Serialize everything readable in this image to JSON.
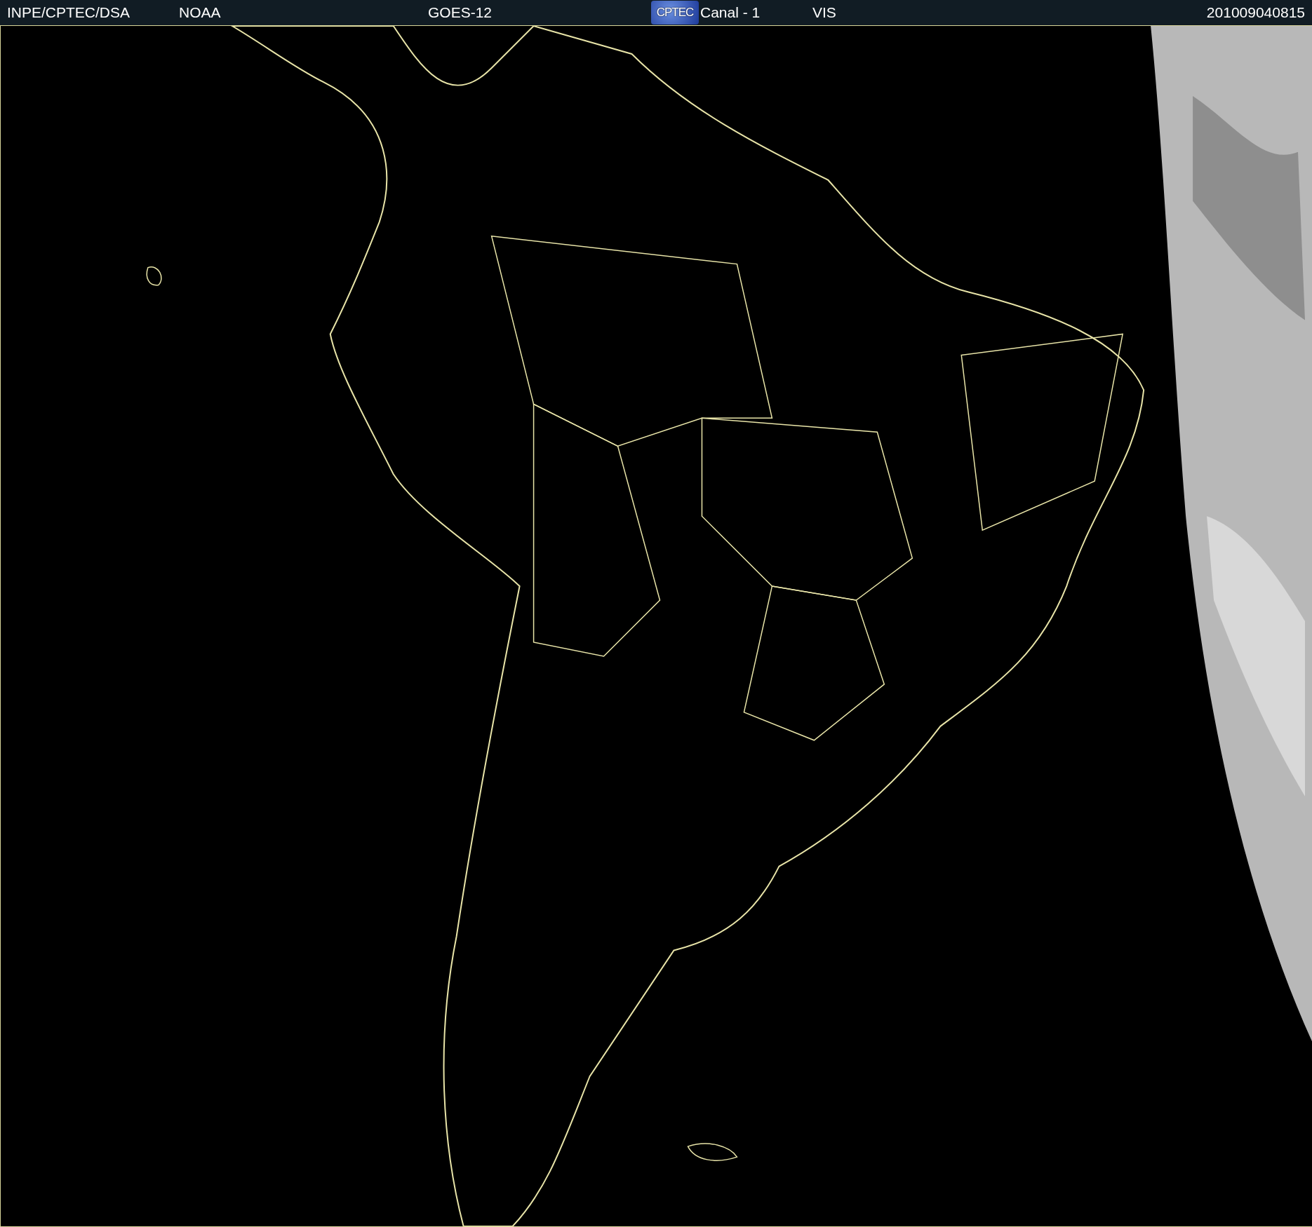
{
  "header": {
    "source": "INPE/CPTEC/DSA",
    "agency": "NOAA",
    "satellite": "GOES-12",
    "logo_text": "CPTEC",
    "channel": "Canal - 1",
    "band": "VIS",
    "timestamp": "201009040815"
  }
}
